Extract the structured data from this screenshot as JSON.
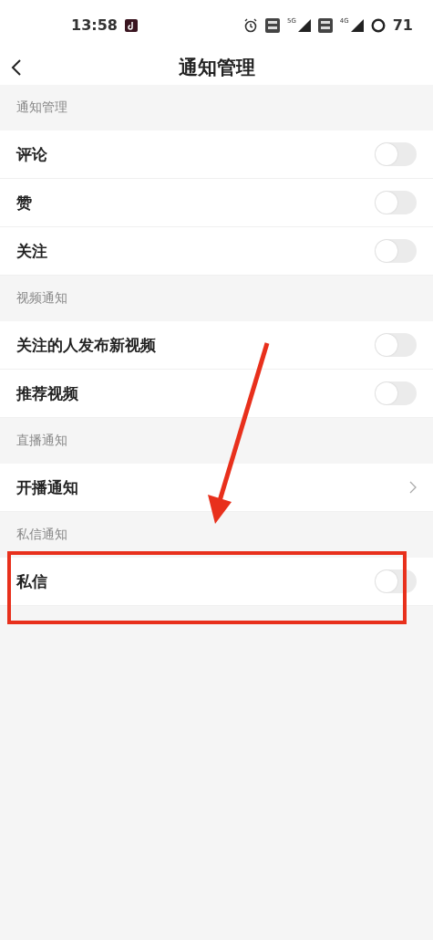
{
  "status_bar": {
    "time": "13:58",
    "networks": [
      "5G",
      "4G"
    ],
    "battery": "71"
  },
  "header": {
    "title": "通知管理"
  },
  "sections": [
    {
      "title": "通知管理",
      "items": [
        {
          "label": "评论",
          "kind": "toggle",
          "on": false
        },
        {
          "label": "赞",
          "kind": "toggle",
          "on": false
        },
        {
          "label": "关注",
          "kind": "toggle",
          "on": false
        }
      ]
    },
    {
      "title": "视频通知",
      "items": [
        {
          "label": "关注的人发布新视频",
          "kind": "toggle",
          "on": false
        },
        {
          "label": "推荐视频",
          "kind": "toggle",
          "on": false
        }
      ]
    },
    {
      "title": "直播通知",
      "items": [
        {
          "label": "开播通知",
          "kind": "link"
        }
      ]
    },
    {
      "title": "私信通知",
      "items": [
        {
          "label": "私信",
          "kind": "toggle",
          "on": false,
          "highlighted": true
        }
      ]
    }
  ],
  "annotation": {
    "arrow": true
  }
}
